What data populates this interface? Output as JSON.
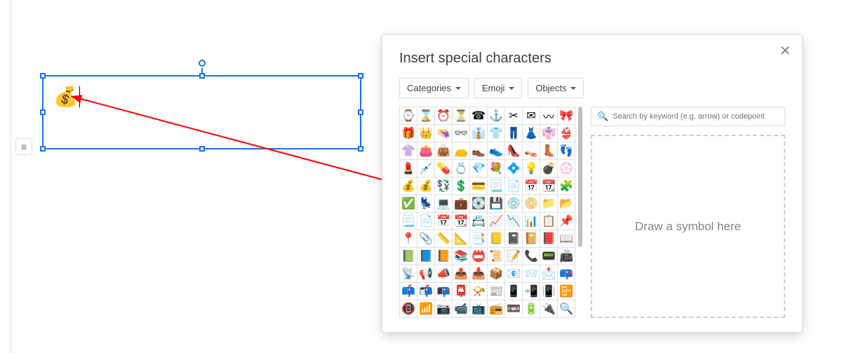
{
  "dialog": {
    "title": "Insert special characters",
    "dropdowns": {
      "categories": "Categories",
      "emoji": "Emoji",
      "objects": "Objects"
    },
    "search_placeholder": "Search by keyword (e.g. arrow) or codepoint",
    "draw_hint": "Draw a symbol here"
  },
  "emoji_rows": [
    [
      "⌚",
      "⌛",
      "⏰",
      "⏳",
      "☎",
      "⚓",
      "✂",
      "✉",
      "〰",
      "🎀"
    ],
    [
      "🎁",
      "👑",
      "👒",
      "👓",
      "👔",
      "👕",
      "👖",
      "👗",
      "👘",
      "👙"
    ],
    [
      "👚",
      "👛",
      "👜",
      "👝",
      "👞",
      "👟",
      "👠",
      "👡",
      "👢",
      "👣"
    ],
    [
      "💄",
      "💉",
      "💊",
      "💍",
      "💎",
      "💐",
      "💠",
      "💡",
      "💣",
      "💮"
    ],
    [
      "💰",
      "💰",
      "💱",
      "💲",
      "💳",
      "📃",
      "📄",
      "📅",
      "📆",
      "🧩"
    ],
    [
      "✅",
      "💺",
      "💻",
      "💼",
      "💽",
      "💾",
      "💿",
      "📀",
      "📁",
      "📂"
    ],
    [
      "📃",
      "📄",
      "📅",
      "📆",
      "📇",
      "📈",
      "📉",
      "📊",
      "📋",
      "📌"
    ],
    [
      "📍",
      "📎",
      "📏",
      "📐",
      "📑",
      "📒",
      "📓",
      "📔",
      "📕",
      "📖"
    ],
    [
      "📗",
      "📘",
      "📙",
      "📚",
      "📛",
      "📜",
      "📝",
      "📞",
      "📟",
      "📠"
    ],
    [
      "📡",
      "📢",
      "📣",
      "📤",
      "📥",
      "📦",
      "📧",
      "📨",
      "📩",
      "📪"
    ],
    [
      "📫",
      "📬",
      "📭",
      "📮",
      "📯",
      "📰",
      "📱",
      "📲",
      "📳",
      "📴"
    ],
    [
      "📵",
      "📶",
      "📷",
      "📹",
      "📺",
      "📻",
      "📼",
      "🔋",
      "🔌",
      "🔍"
    ]
  ],
  "textbox": {
    "emoji": "💰"
  },
  "labels": {
    "align_icon": "≡"
  }
}
